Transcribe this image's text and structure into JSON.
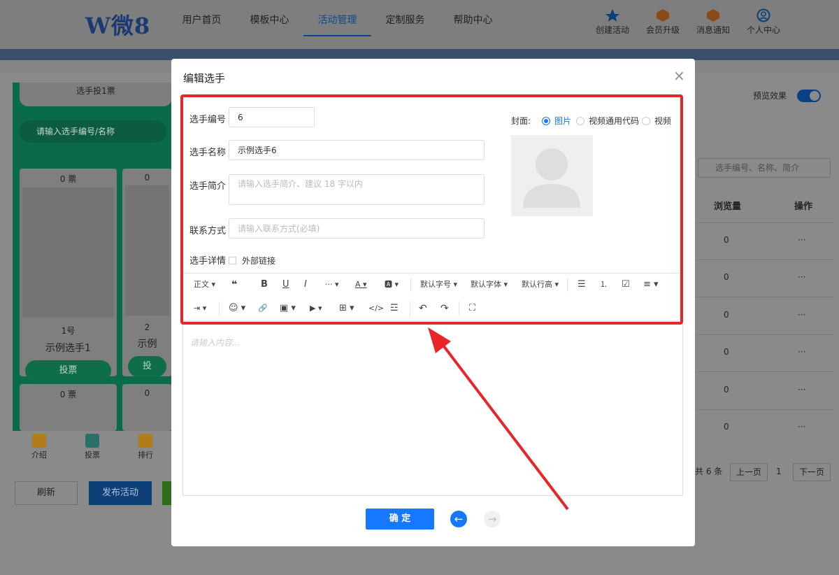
{
  "nav": {
    "logo_w": "W",
    "logo_text": "微8",
    "links": [
      {
        "label": "用户首页"
      },
      {
        "label": "模板中心"
      },
      {
        "label": "活动管理"
      },
      {
        "label": "定制服务"
      },
      {
        "label": "帮助中心"
      }
    ],
    "icons": [
      {
        "label": "创建活动",
        "icon": "star-icon"
      },
      {
        "label": "会员升级",
        "icon": "vip-badge-icon"
      },
      {
        "label": "消息通知",
        "icon": "bell-badge-icon"
      },
      {
        "label": "个人中心",
        "icon": "user-icon"
      }
    ]
  },
  "phone": {
    "tab_label": "选手投1票",
    "search_placeholder": "请输入选手编号/名称",
    "cards": [
      {
        "votes": "0 票",
        "number": "1号",
        "name": "示例选手1",
        "vote_label": "投票"
      },
      {
        "votes": "0",
        "number": "2",
        "name": "示例",
        "vote_label": "投"
      },
      {
        "votes": "0 票"
      },
      {
        "votes": "0"
      }
    ],
    "tabbar": [
      {
        "label": "介绍"
      },
      {
        "label": "投票"
      },
      {
        "label": "排行"
      }
    ]
  },
  "bottom_buttons": {
    "refresh": "刷新",
    "publish": "发布活动"
  },
  "right_panel": {
    "preview_label": "预览效果",
    "search_placeholder": "选手编号、名称、简介",
    "col_views": "浏览量",
    "col_actions": "操作",
    "rows": [
      {
        "views": "0",
        "action": "···"
      },
      {
        "views": "0",
        "action": "···"
      },
      {
        "views": "0",
        "action": "···"
      },
      {
        "views": "0",
        "action": "···"
      },
      {
        "views": "0",
        "action": "···"
      },
      {
        "views": "0",
        "action": "···"
      }
    ],
    "pagination": {
      "total": "共 6 条",
      "prev": "上一页",
      "page": "1",
      "next": "下一页"
    }
  },
  "modal": {
    "title": "编辑选手",
    "close": "×",
    "number_label": "选手编号",
    "number_value": "6",
    "name_label": "选手名称",
    "name_value": "示例选手6",
    "intro_label": "选手简介",
    "intro_placeholder": "请输入选手简介、建议 18 字以内",
    "contact_label": "联系方式",
    "contact_placeholder": "请输入联系方式(必填)",
    "detail_label": "选手详情",
    "external_link": "外部链接",
    "cover_label": "封面:",
    "cover_options": [
      {
        "label": "图片",
        "selected": true
      },
      {
        "label": "视频通用代码",
        "selected": false
      },
      {
        "label": "视频",
        "selected": false
      }
    ],
    "toolbar_row1": [
      "正文 ▾",
      "❝",
      "B",
      "U",
      "I",
      "··· ▾",
      "A ▾",
      "🅰 ▾",
      "默认字号 ▾",
      "默认字体 ▾",
      "默认行高 ▾",
      "☰",
      "⒈",
      "☑",
      "≡ ▾"
    ],
    "toolbar_row2": [
      "⇥ ▾",
      "☺ ▾",
      "🔗",
      "▣ ▾",
      "▶ ▾",
      "⊞ ▾",
      "</>",
      "☲",
      "↶",
      "↷",
      "⛶"
    ],
    "editor_placeholder": "请输入内容...",
    "ok_label": "确 定",
    "back_icon": "←",
    "forward_icon": "→"
  },
  "colors": {
    "primary": "#1677ff",
    "highlight": "#e8262a",
    "green": "#0a6b4a"
  }
}
